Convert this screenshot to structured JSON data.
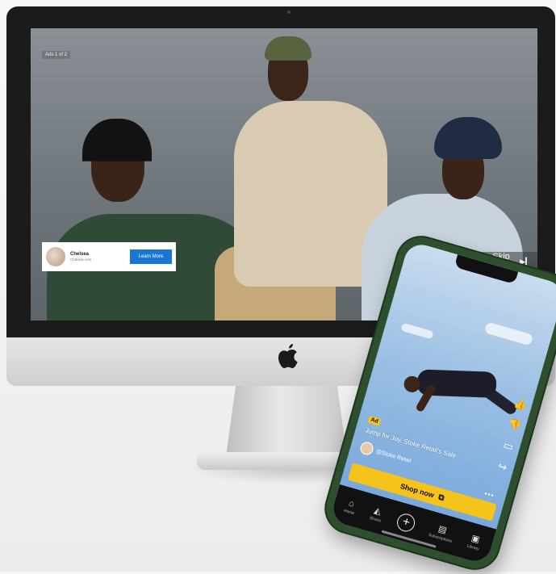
{
  "desktop_ad": {
    "counter": "Ads 1 of 2",
    "advertiser": {
      "name": "Chelsea",
      "domain": "Chelsea.com"
    },
    "cta_label": "Learn More",
    "skip_label": "Skip Ads",
    "skip_icon": "skip-next-icon"
  },
  "mobile_ad": {
    "badge": "Ad",
    "caption": "Jump for Joy. Stoke Retail's Sale",
    "channel": "@Stoke Retail",
    "cta_label": "Shop now",
    "cta_icon": "open-external-icon",
    "nav": [
      {
        "label": "Home",
        "icon": "home-icon"
      },
      {
        "label": "Shorts",
        "icon": "shorts-icon"
      },
      {
        "label": "",
        "icon": "create-plus-icon"
      },
      {
        "label": "Subscriptions",
        "icon": "subscriptions-icon"
      },
      {
        "label": "Library",
        "icon": "library-icon"
      }
    ]
  },
  "colors": {
    "learn_more_button": "#1976d2",
    "shop_now_button": "#f6c21c",
    "phone_frame": "#2e4f2d"
  }
}
